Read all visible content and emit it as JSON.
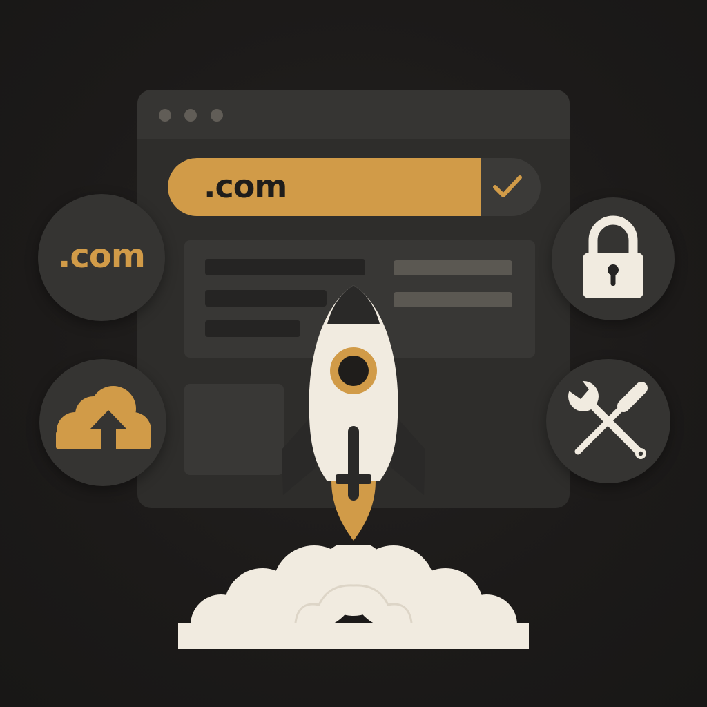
{
  "browser": {
    "window_dots": [
      "dot",
      "dot",
      "dot"
    ]
  },
  "domain_bar": {
    "text": ".com",
    "status_icon": "check-icon",
    "accent_color": "#d19b48"
  },
  "badges": {
    "domain": {
      "text": ".com",
      "icon": "domain-text"
    },
    "upload": {
      "icon": "cloud-upload-icon"
    },
    "security": {
      "icon": "lock-icon"
    },
    "tools": {
      "icon": "wrench-screwdriver-icon"
    }
  },
  "illustration": {
    "main": "rocket-icon",
    "exhaust": "cloud-smoke"
  },
  "colors": {
    "background": "#1e1c1b",
    "panel": "#2e2d2b",
    "accent": "#d19b48",
    "cream": "#f1ebe0",
    "dark": "#252423"
  }
}
